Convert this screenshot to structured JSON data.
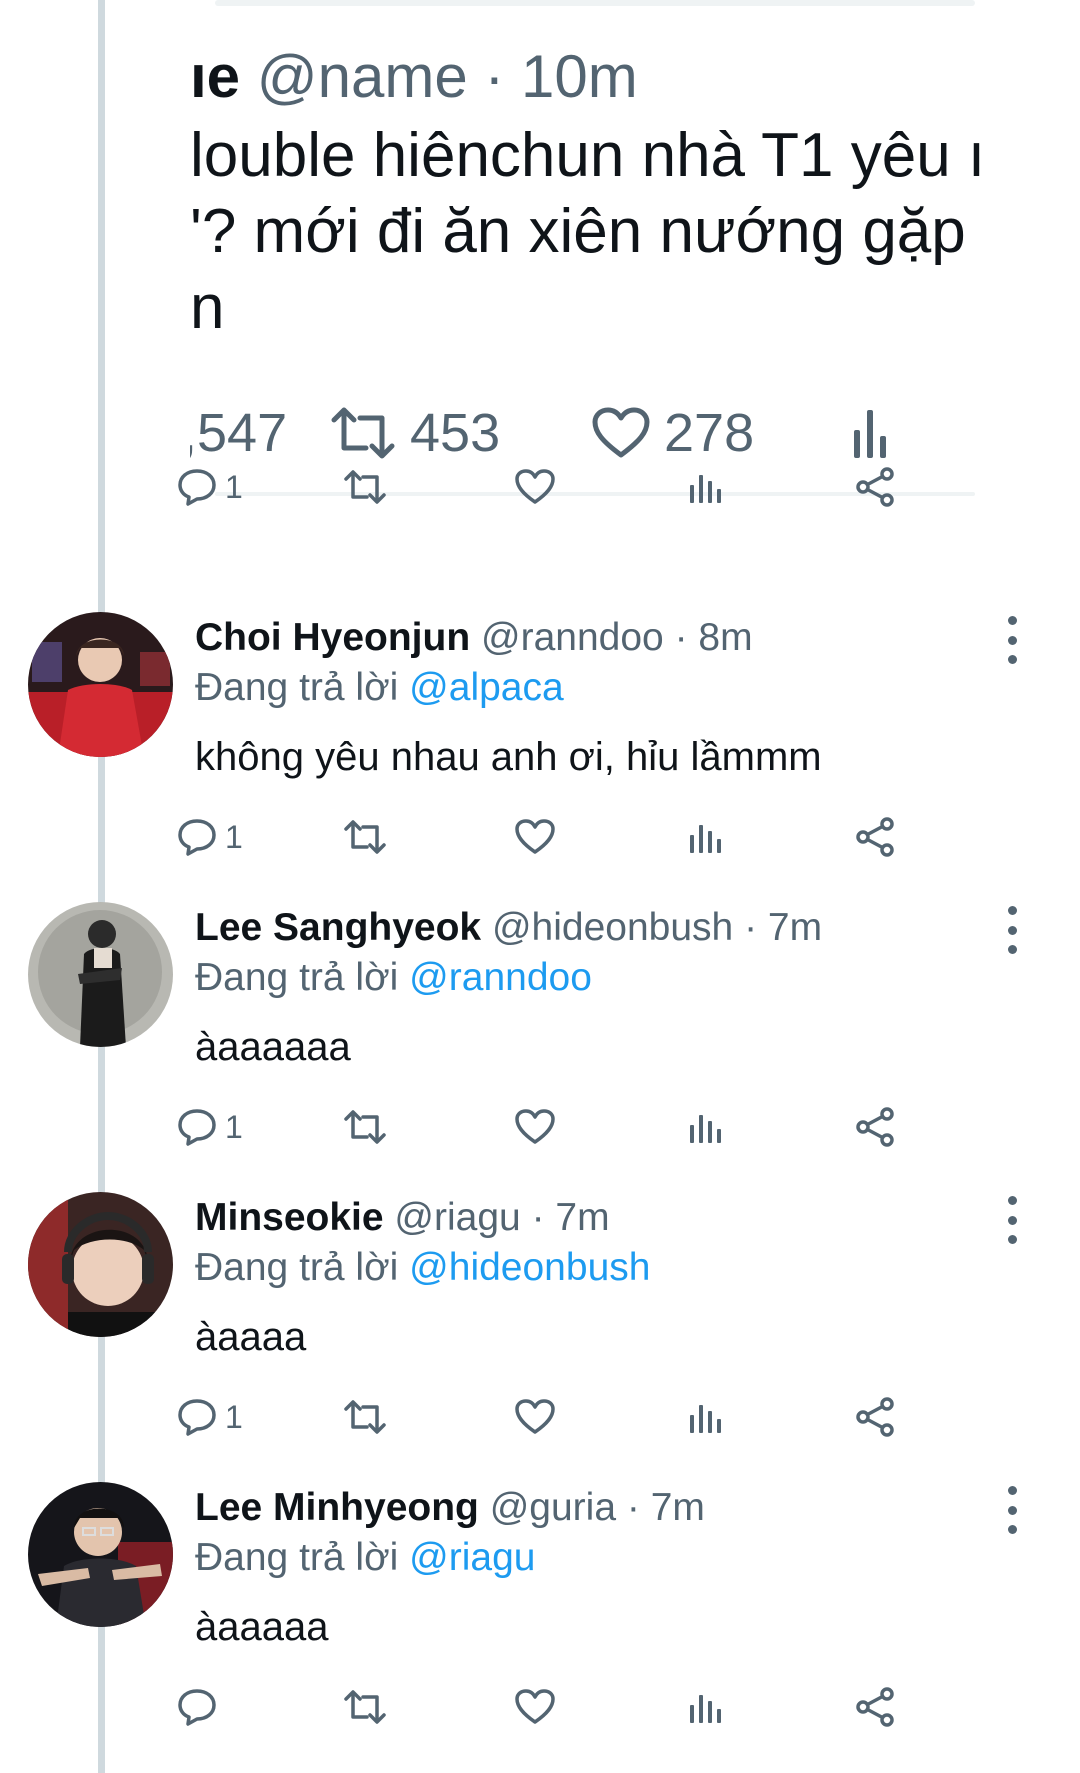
{
  "quoted_tweet": {
    "name_fragment": "ıe",
    "handle": "@name",
    "separator": "·",
    "time": "10m",
    "lines": [
      "louble hiênchun nhà T1 yêu ı",
      "'? mới đi ăn xiên nướng gặp",
      "n"
    ],
    "stats": {
      "views_fragment": ",547",
      "retweets": "453",
      "likes": "278"
    }
  },
  "top_actions": {
    "reply_count": "1"
  },
  "replies": [
    {
      "name": "Choi Hyeonjun",
      "handle": "@ranndoo",
      "separator": "·",
      "time": "8m",
      "replying_prefix": "Đang trả lời",
      "replying_to": "@alpaca",
      "text": "không yêu nhau anh ơi, hỉu lầmmm",
      "reply_count": "1",
      "avatar_color": "#c8232c"
    },
    {
      "name": "Lee Sanghyeok",
      "handle": "@hideonbush",
      "separator": "·",
      "time": "7m",
      "replying_prefix": "Đang trả lời",
      "replying_to": "@ranndoo",
      "text": "àaaaaaa",
      "reply_count": "1",
      "avatar_color": "#9a9a95"
    },
    {
      "name": "Minseokie",
      "handle": "@riagu",
      "separator": "·",
      "time": "7m",
      "replying_prefix": "Đang trả lời",
      "replying_to": "@hideonbush",
      "text": "àaaaa",
      "reply_count": "1",
      "avatar_color": "#5a3a34"
    },
    {
      "name": "Lee Minhyeong",
      "handle": "@guria",
      "separator": "·",
      "time": "7m",
      "replying_prefix": "Đang trả lời",
      "replying_to": "@riagu",
      "text": "àaaaaa",
      "reply_count": "",
      "avatar_color": "#1f1f24"
    }
  ],
  "colors": {
    "text": "#0f1419",
    "muted": "#536471",
    "link": "#1d9bf0",
    "thread_line": "#cfd9de"
  },
  "icons": [
    "reply-icon",
    "retweet-icon",
    "like-icon",
    "views-icon",
    "share-icon",
    "more-icon"
  ]
}
